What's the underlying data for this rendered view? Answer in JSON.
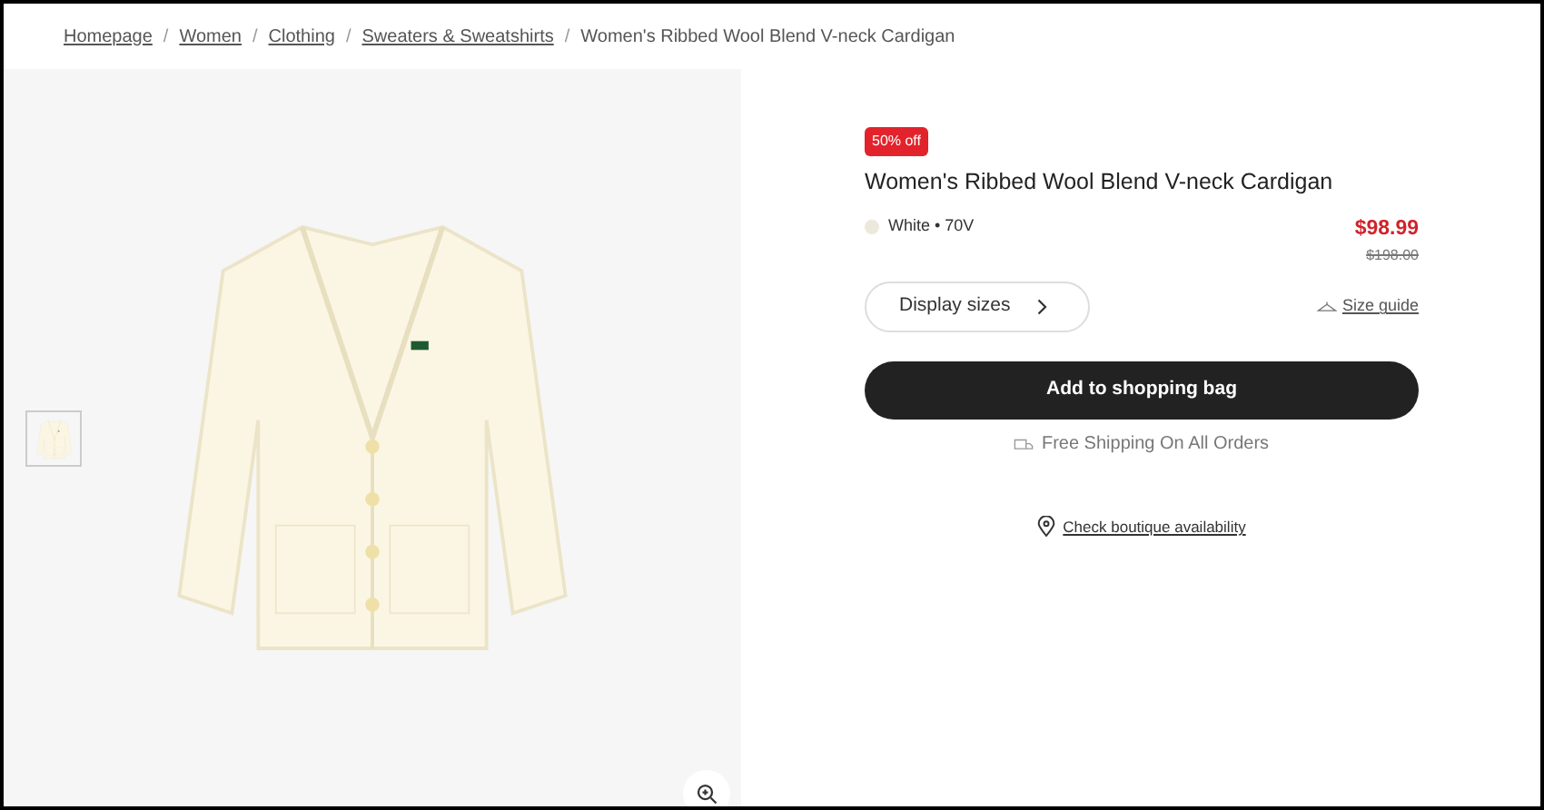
{
  "breadcrumb": [
    {
      "label": "Homepage",
      "kind": "link"
    },
    {
      "label": "Women",
      "kind": "link"
    },
    {
      "label": "Clothing",
      "kind": "link"
    },
    {
      "label": "Sweaters & Sweatshirts",
      "kind": "link"
    },
    {
      "label": "Women's Ribbed Wool Blend V-neck Cardigan",
      "kind": "current"
    }
  ],
  "breadcrumb_separator": "/",
  "product": {
    "badge": "50% off",
    "title": "Women's Ribbed Wool Blend V-neck Cardigan",
    "color_label": "White • 70V",
    "price": "$98.99",
    "original_price": "$198.00"
  },
  "size_button": "Display sizes",
  "size_guide": "Size guide",
  "add_button": "Add to shopping bag",
  "shipping_note": "Free Shipping On All Orders",
  "boutique_link": "Check boutique availability"
}
